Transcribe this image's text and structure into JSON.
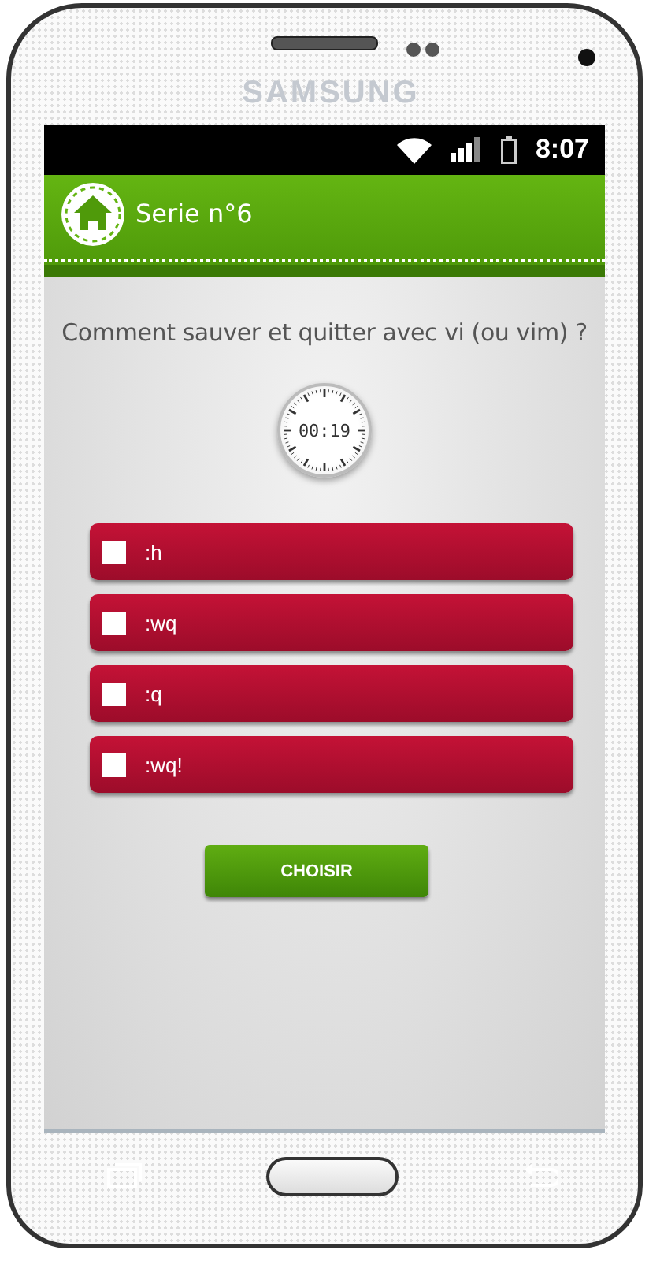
{
  "device": {
    "brand": "SAMSUNG"
  },
  "status_bar": {
    "time": "8:07"
  },
  "header": {
    "title": "Serie n°6"
  },
  "question": "Comment sauver et quitter avec vi (ou vim) ?",
  "timer": {
    "reading": "00:19"
  },
  "answers": [
    {
      "label": ":h",
      "checked": false
    },
    {
      "label": ":wq",
      "checked": false
    },
    {
      "label": ":q",
      "checked": false
    },
    {
      "label": ":wq!",
      "checked": false
    }
  ],
  "submit": {
    "label": "CHOISIR"
  }
}
